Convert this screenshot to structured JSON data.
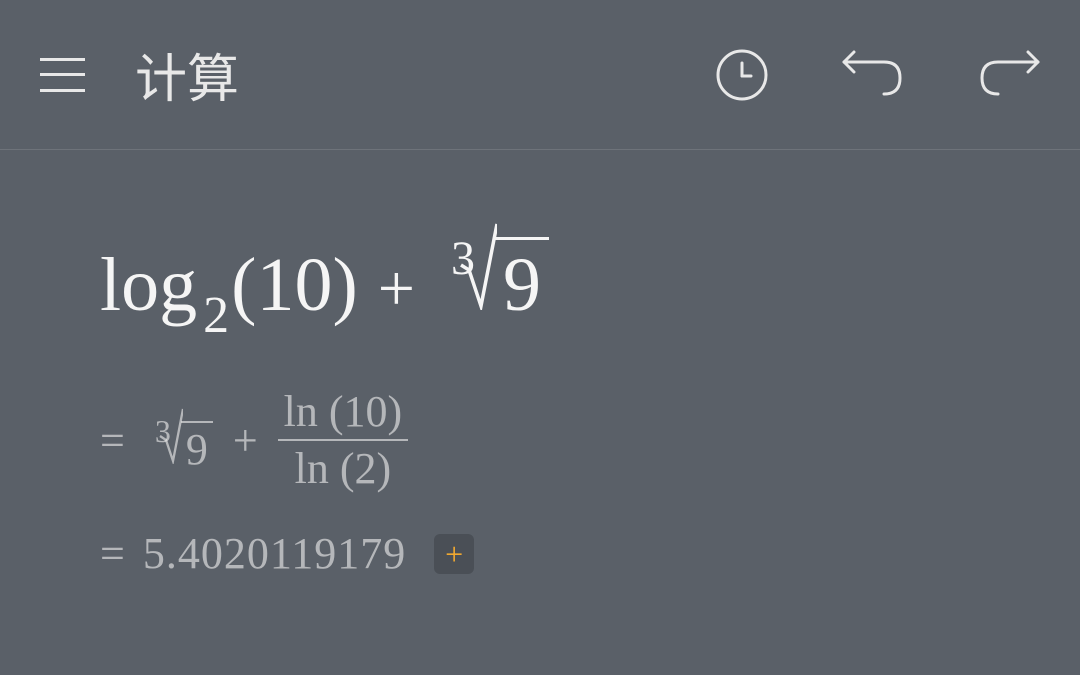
{
  "header": {
    "title": "计算"
  },
  "expression": {
    "log_label": "log",
    "log_base": "2",
    "log_arg": "10",
    "plus": "+",
    "root_index": "3",
    "root_radicand": "9"
  },
  "step1": {
    "equals": "=",
    "root_index": "3",
    "root_radicand": "9",
    "plus": "+",
    "frac_top": "ln (10)",
    "frac_bot": "ln (2)"
  },
  "result": {
    "equals": "=",
    "value": "5.4020119179"
  },
  "icons": {
    "plus_symbol": "+"
  }
}
